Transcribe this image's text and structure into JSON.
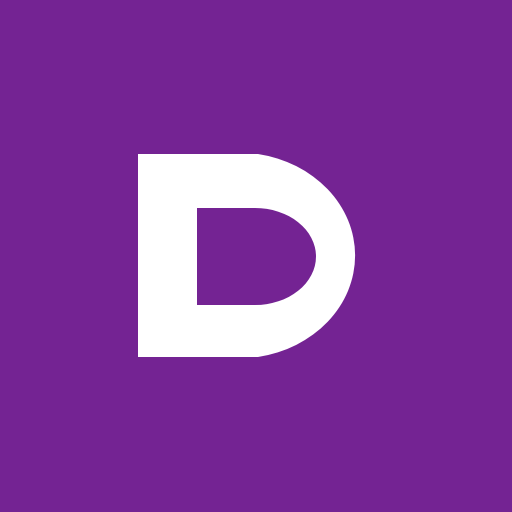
{
  "logo": {
    "letter": "D",
    "background_color": "#742393",
    "letter_color": "#FFFFFF"
  }
}
